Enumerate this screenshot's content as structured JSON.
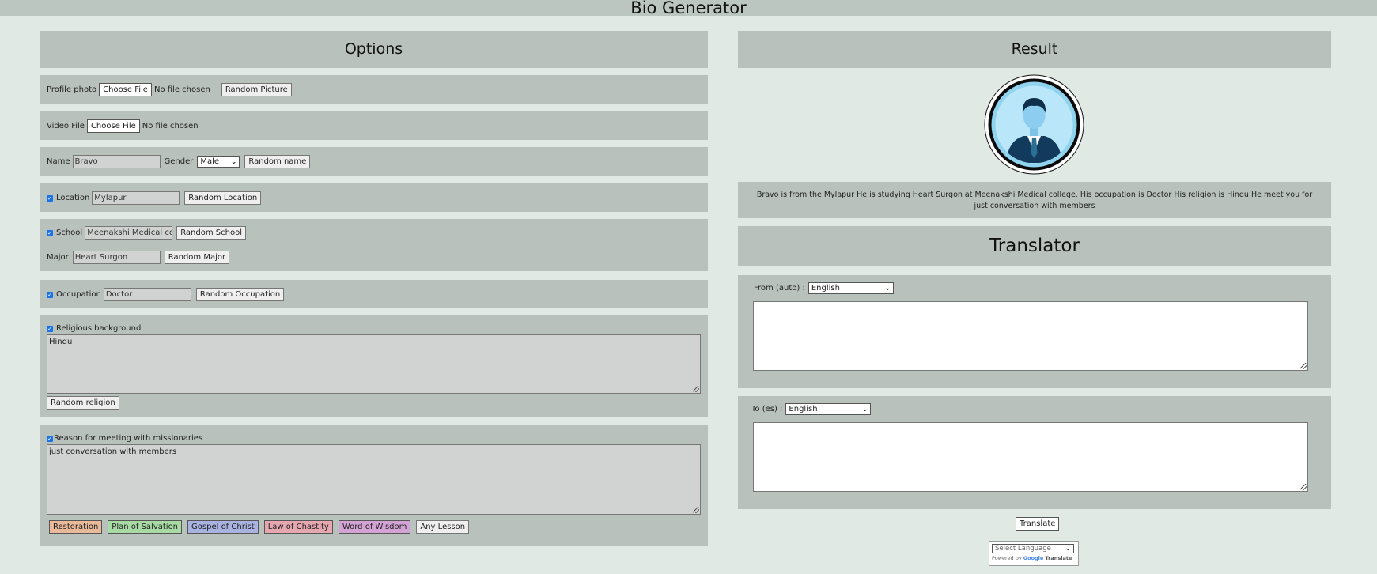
{
  "app": {
    "title": "Bio Generator"
  },
  "options": {
    "heading": "Options",
    "profile_photo": {
      "label": "Profile photo",
      "choose_label": "Choose File",
      "status": "No file chosen",
      "random_label": "Random Picture"
    },
    "video_file": {
      "label": "Video File",
      "choose_label": "Choose File",
      "status": "No file chosen"
    },
    "name": {
      "label": "Name",
      "value": "Bravo",
      "gender_label": "Gender",
      "gender_value": "Male",
      "random_label": "Random name"
    },
    "location": {
      "checked": true,
      "label": "Location",
      "value": "Mylapur",
      "random_label": "Random Location"
    },
    "school": {
      "checked": true,
      "label": "School",
      "value": "Meenakshi Medical colleg",
      "random_label": "Random School"
    },
    "major": {
      "label": "Major",
      "value": "Heart Surgon",
      "random_label": "Random Major"
    },
    "occupation": {
      "checked": true,
      "label": "Occupation",
      "value": "Doctor",
      "random_label": "Random Occupation"
    },
    "religion": {
      "checked": true,
      "label": "Religious background",
      "value": "Hindu",
      "random_label": "Random religion"
    },
    "reason": {
      "checked": true,
      "label": "Reason for meeting with missionaries",
      "value": "just conversation with members"
    },
    "lessons": [
      {
        "label": "Restoration",
        "color": "#e9b99a"
      },
      {
        "label": "Plan of Salvation",
        "color": "#a8dba4"
      },
      {
        "label": "Gospel of Christ",
        "color": "#a9b2e0"
      },
      {
        "label": "Law of Chastity",
        "color": "#e6a7b0"
      },
      {
        "label": "Word of Wisdom",
        "color": "#d4a3d6"
      },
      {
        "label": "Any Lesson",
        "color": "#efefef"
      }
    ]
  },
  "result": {
    "heading": "Result",
    "avatar_icon": "businessman-avatar-icon",
    "bio": "Bravo is from the Mylapur He is studying Heart Surgon at Meenakshi Medical college. His occupation is Doctor His religion is Hindu He meet you for just conversation with members"
  },
  "translator": {
    "heading": "Translator",
    "from_label": "From (auto) :",
    "from_value": "English",
    "from_text": "",
    "to_label": "To (es) :",
    "to_value": "English",
    "to_text": "",
    "translate_label": "Translate",
    "widget": {
      "select_label": "Select Language",
      "powered_by": "Powered by",
      "google": "Google",
      "translate_word": "Translate"
    }
  },
  "colors": {
    "page_bg": "#e0e9e4",
    "panel_bg": "#b8c1bc",
    "accent_check": "#1a73e8"
  }
}
